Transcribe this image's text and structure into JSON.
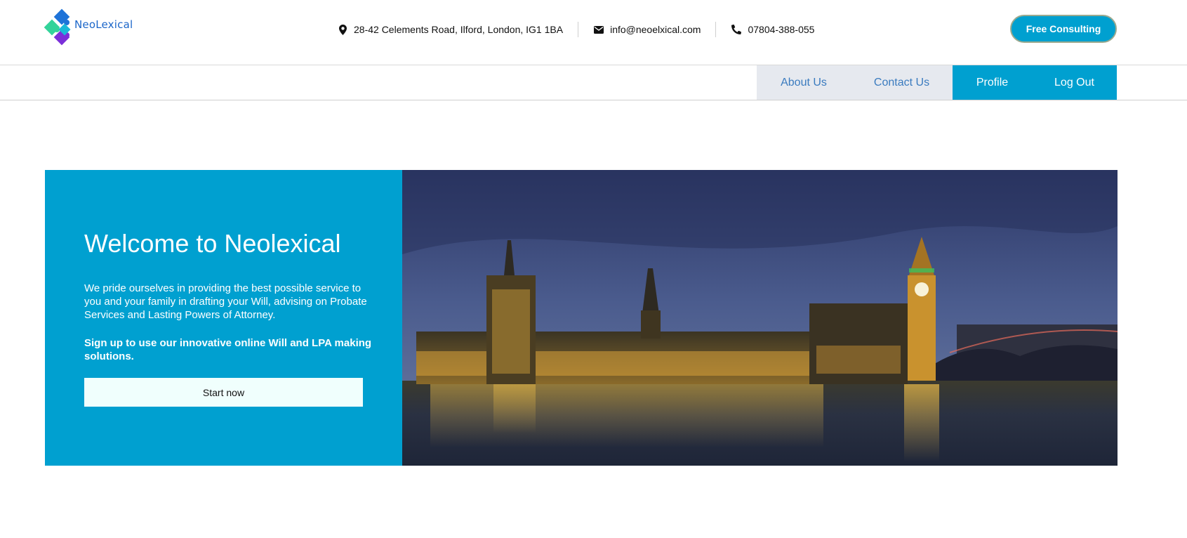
{
  "brand": {
    "name": "NeoLexical"
  },
  "contact": {
    "address": "28-42 Celements Road, Ilford, London, IG1 1BA",
    "email": "info@neoelxical.com",
    "phone": "07804-388-055"
  },
  "header": {
    "consult_label": "Free Consulting"
  },
  "nav": {
    "about": "About Us",
    "contact": "Contact Us",
    "profile": "Profile",
    "logout": "Log Out"
  },
  "hero": {
    "title": "Welcome to Neolexical",
    "description": "We pride ourselves in providing the best possible service to you and your family in drafting your Will, advising on Probate Services and Lasting Powers of Attorney.",
    "cta_text": "Sign up to use our innovative online Will and LPA making solutions.",
    "start_label": "Start now"
  },
  "icons": {
    "address": "map-marker-icon",
    "email": "envelope-icon",
    "phone": "phone-icon"
  },
  "colors": {
    "accent": "#00a0d0",
    "nav_light_bg": "#e6e9ef",
    "nav_light_text": "#3a7bbf",
    "logo_text": "#1b66c9"
  }
}
